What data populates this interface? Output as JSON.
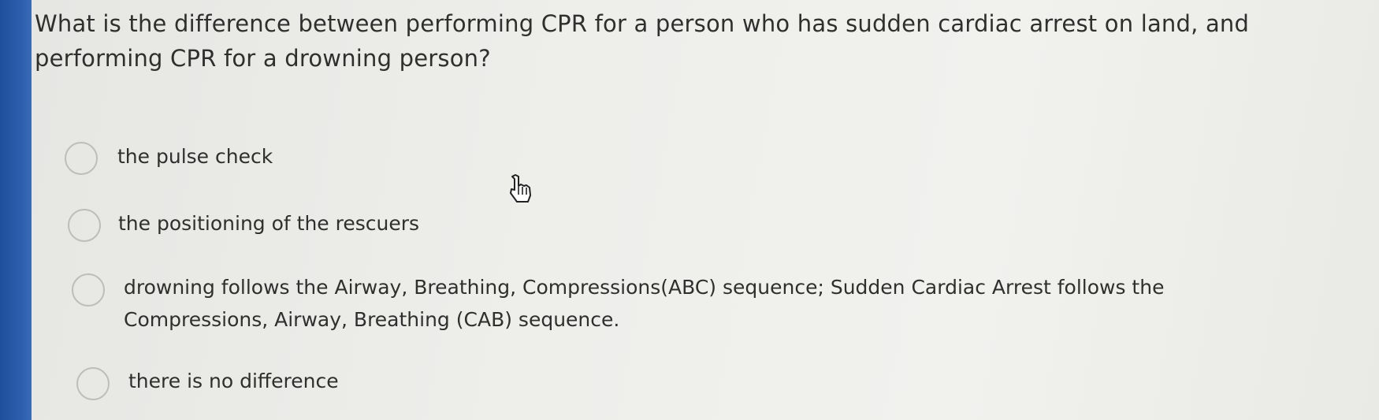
{
  "question": {
    "text": "What is the difference between performing CPR for a person who has sudden cardiac arrest on land, and performing CPR for a drowning person?"
  },
  "options": [
    {
      "label": "the pulse check"
    },
    {
      "label": "the positioning of the rescuers"
    },
    {
      "label": "drowning follows the Airway, Breathing, Compressions(ABC) sequence; Sudden Cardiac Arrest follows the Compressions, Airway, Breathing (CAB) sequence."
    },
    {
      "label": "there is no difference"
    }
  ],
  "cursor": {
    "icon": "hand-pointer-icon"
  },
  "colors": {
    "sidebar": "#2b5fae",
    "background": "#ececea",
    "text": "#2f2f2f",
    "radio_border": "#bdbdbb"
  }
}
